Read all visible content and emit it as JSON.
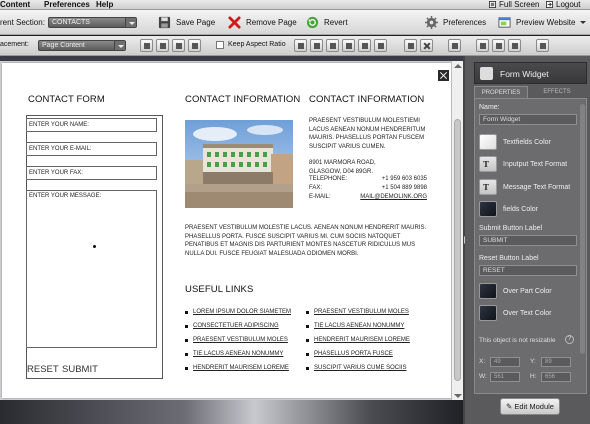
{
  "menubar": {
    "items": [
      "Content",
      "Preferences",
      "Help"
    ],
    "full_screen": "Full Screen",
    "logout": "Logout"
  },
  "toolbar": {
    "section_label": "rent Section:",
    "section_value": "CONTACTS",
    "save": "Save Page",
    "remove": "Remove Page",
    "revert": "Revert",
    "preferences": "Preferences",
    "preview": "Preview Website"
  },
  "toolbar2": {
    "placement_label": "acement:",
    "placement_value": "Page Content",
    "keep_aspect": "Keep Aspect Ratio"
  },
  "page": {
    "contact_form": {
      "title": "CONTACT FORM",
      "fields": [
        "ENTER YOUR NAME:",
        "ENTER YOUR E-MAIL:",
        "ENTER YOUR FAX:"
      ],
      "message": "ENTER YOUR MESSAGE:",
      "reset": "RESET",
      "submit": "SUBMIT"
    },
    "contact_info_left": {
      "title": "CONTACT INFORMATION",
      "paragraph": "PRAESENT VESTIBULUM MOLESTIE LACUS. AENEAN NONUM HENDRERIT MAURIS. PHASELLUS PORTA. FUSCE SUSCIPIT VARIUS MI. CUM SOCIIS NATOQUET PENATIBUS ET MAGNIS DIS PARTURIENT MONTES NASCETUR RIDICULUS MUS NULLA DUI. FUSCE FEUGIAT MALESUADA ODIOMEN MORBI."
    },
    "contact_info_right": {
      "title": "CONTACT INFORMATION",
      "paragraph": "PRAESENT VESTIBULUM MOLESTIEMI LACUS AENEAN NONUM HENDRERITUM MAURIS. PHASELLUS PORTAN FUSCEM SUSCIPIT VARIUS CUMEN.",
      "address": "8901 MARMORA ROAD, GLASGOW, D04 89GR.",
      "rows": [
        {
          "k": "TELEPHONE:",
          "v": "+1 959 603 6035"
        },
        {
          "k": "FAX:",
          "v": "+1 504 889 9898"
        },
        {
          "k": "E-MAIL:",
          "v": "MAIL@DEMOLINK.ORG"
        }
      ]
    },
    "useful_links": {
      "title": "USEFUL LINKS",
      "col1": [
        "LOREM IPSUM DOLOR SIAMETEM",
        "CONSECTETUER ADIPISCING",
        "PRAESENT VESTIBULUM MOLES",
        "TIE LACUS AENEAN NONUMMY",
        "HENDRERIT MAURISEM LOREME"
      ],
      "col2": [
        "PRAESENT VESTIBULUM MOLES",
        "TIE LACUS AENEAN NONUMMY",
        "HENDRERIT MAURISEM LOREME",
        "PHASELLUS PORTA FUSCE",
        "SUSCIPIT VARIUS CUME SOCIIS"
      ]
    }
  },
  "panel": {
    "title": "Form Widget",
    "tabs": [
      "PROPERTIES",
      "EFFECTS"
    ],
    "name_label": "Name:",
    "name_value": "Form Widget",
    "swatches_top": [
      {
        "label": "Textfields Color",
        "kind": "white"
      },
      {
        "label": "Inputput Text Format",
        "kind": "tt"
      },
      {
        "label": "Message Text Format",
        "kind": "tt"
      },
      {
        "label": "fields Color",
        "kind": "dark"
      }
    ],
    "submit_label": "Submit Button Label",
    "submit_value": "SUBMIT",
    "reset_label": "Reset Button Label",
    "reset_value": "RESET",
    "swatches_bottom": [
      {
        "label": "Over Part Color",
        "kind": "dark"
      },
      {
        "label": "Over Text Color",
        "kind": "dark"
      }
    ],
    "note": "This object is not resizable",
    "help": "?",
    "coords": {
      "x_label": "X:",
      "x": "49",
      "y_label": "Y:",
      "y": "89",
      "w_label": "W:",
      "w": "561",
      "h_label": "H:",
      "h": "656"
    },
    "edit_button": "Edit Module"
  },
  "colors": {
    "panel_bg": "#5a5a5c",
    "canvas_bg": "#d2d3d7"
  }
}
